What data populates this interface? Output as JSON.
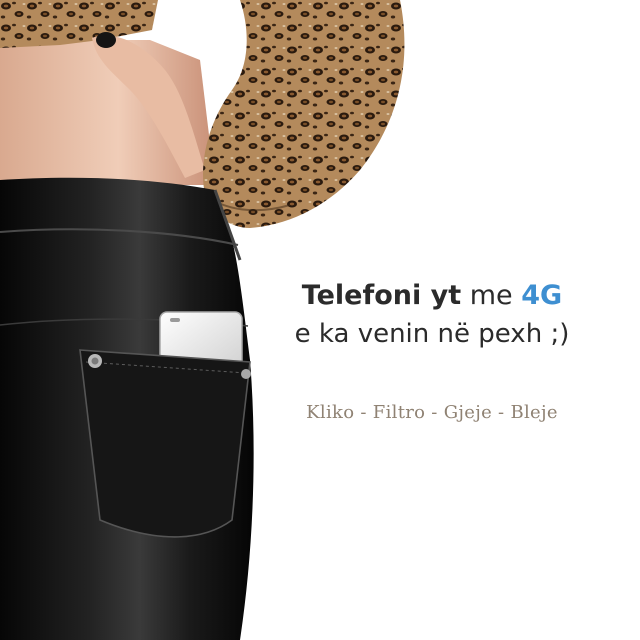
{
  "ad": {
    "headline": {
      "bold_text": "Telefoni yt",
      "plain_text": "me",
      "accent_text": "4G",
      "second_line": "e ka venin në pexh ;)"
    },
    "tagline": "Kliko - Filtro - Gjeje - Bleje"
  },
  "colors": {
    "accent": "#3e8fd1",
    "headline": "#2b2b2b",
    "tagline": "#8f8273",
    "background": "#ffffff"
  }
}
